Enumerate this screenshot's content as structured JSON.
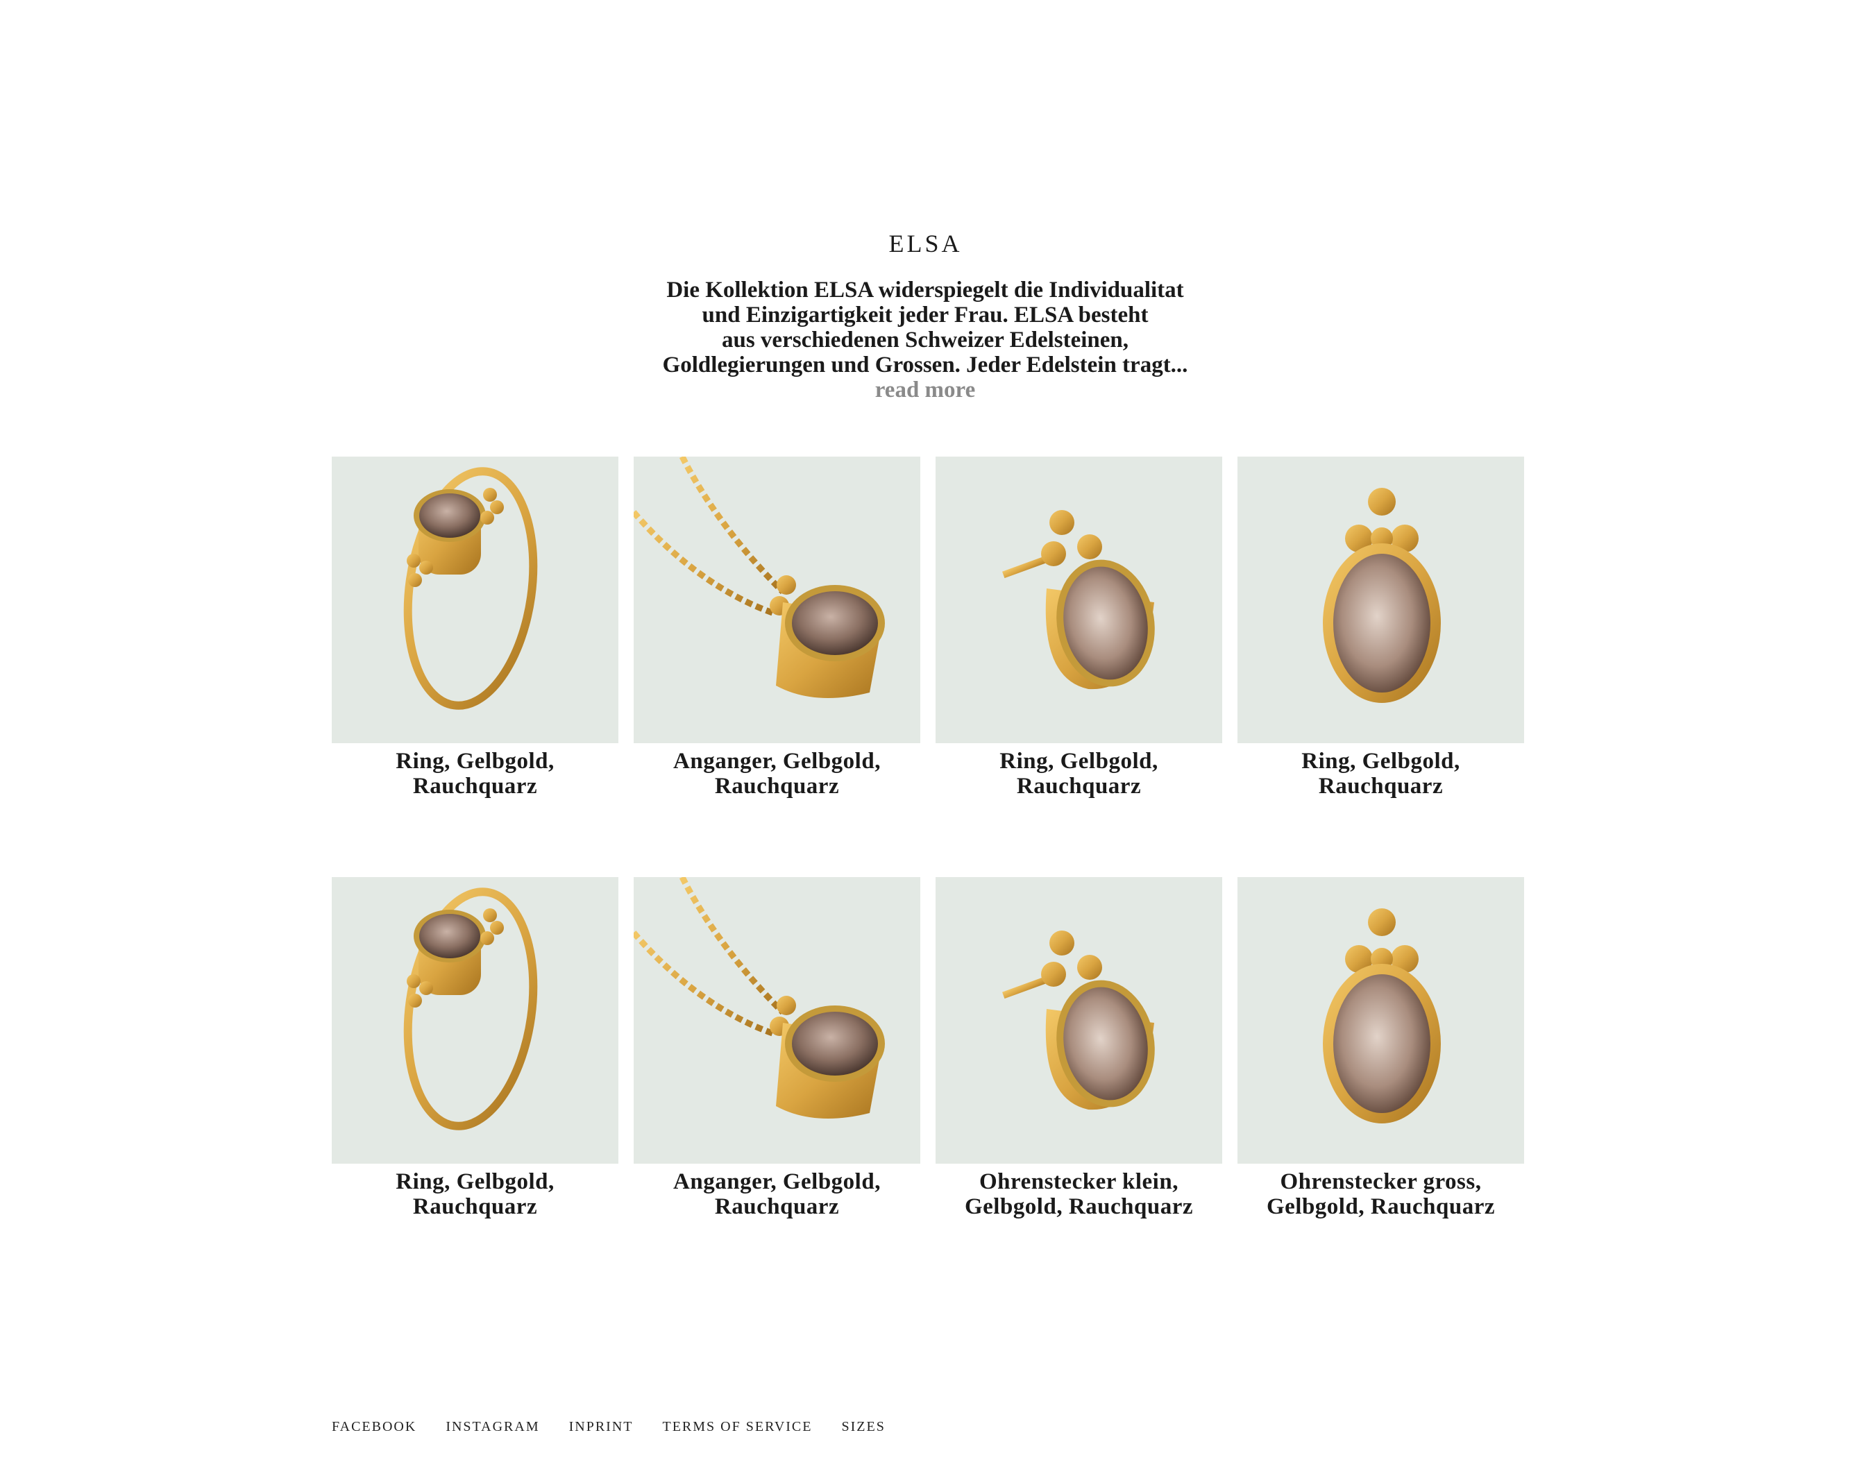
{
  "collection": {
    "title": "ELSA",
    "intro_lines": [
      "Die Kollektion ELSA widerspiegelt die Individualitat",
      "und Einzigartigkeit jeder Frau. ELSA besteht",
      "aus verschiedenen Schweizer Edelsteinen,",
      "Goldlegierungen und Grossen. Jeder Edelstein tragt..."
    ],
    "read_more": "read more"
  },
  "products": [
    {
      "line1": "Ring, Gelbgold,",
      "line2": "Rauchquarz",
      "image": "ring-image"
    },
    {
      "line1": "Anganger, Gelbgold,",
      "line2": "Rauchquarz",
      "image": "pendant-image"
    },
    {
      "line1": "Ring, Gelbgold,",
      "line2": "Rauchquarz",
      "image": "earring-small-image"
    },
    {
      "line1": "Ring, Gelbgold,",
      "line2": "Rauchquarz",
      "image": "earring-large-image"
    },
    {
      "line1": "Ring, Gelbgold,",
      "line2": "Rauchquarz",
      "image": "ring-image"
    },
    {
      "line1": "Anganger, Gelbgold,",
      "line2": "Rauchquarz",
      "image": "pendant-image"
    },
    {
      "line1": "Ohrenstecker klein,",
      "line2": "Gelbgold, Rauchquarz",
      "image": "earring-small-image"
    },
    {
      "line1": "Ohrenstecker gross,",
      "line2": "Gelbgold, Rauchquarz",
      "image": "earring-large-image"
    }
  ],
  "footer": {
    "links": [
      "FACEBOOK",
      "INSTAGRAM",
      "INPRINT",
      "TERMS OF SERVICE",
      "SIZES"
    ]
  },
  "colors": {
    "background": "#ffffff",
    "tile": "#e3e9e4",
    "gold": "#d9a441",
    "stone": "#8a6f62",
    "read_more": "#8a8a8a"
  }
}
